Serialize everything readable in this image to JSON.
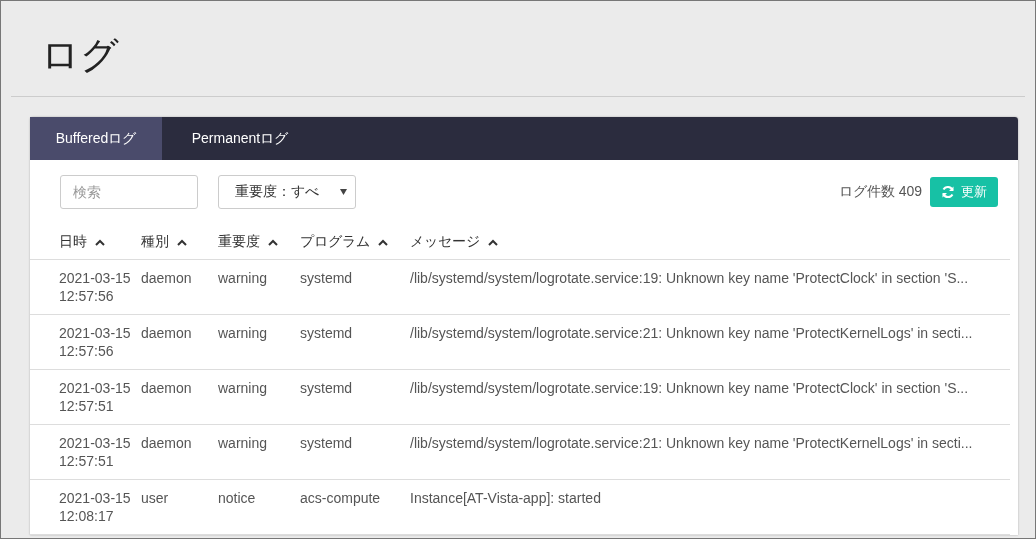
{
  "page": {
    "title": "ログ"
  },
  "tabs": [
    {
      "label": "Bufferedログ",
      "selected": true
    },
    {
      "label": "Permanentログ",
      "selected": false
    }
  ],
  "search": {
    "placeholder": "検索"
  },
  "severity_filter": {
    "value": "重要度：すべ"
  },
  "log_count": "ログ件数 409",
  "refresh_button": "更新",
  "table": {
    "columns": [
      "日時",
      "種別",
      "重要度",
      "プログラム",
      "メッセージ"
    ],
    "rows": [
      {
        "date": "2021-03-15",
        "time": "12:57:56",
        "type": "daemon",
        "severity": "warning",
        "program": "systemd",
        "message": "/lib/systemd/system/logrotate.service:19: Unknown key name 'ProtectClock' in section 'S..."
      },
      {
        "date": "2021-03-15",
        "time": "12:57:56",
        "type": "daemon",
        "severity": "warning",
        "program": "systemd",
        "message": "/lib/systemd/system/logrotate.service:21: Unknown key name 'ProtectKernelLogs' in secti..."
      },
      {
        "date": "2021-03-15",
        "time": "12:57:51",
        "type": "daemon",
        "severity": "warning",
        "program": "systemd",
        "message": "/lib/systemd/system/logrotate.service:19: Unknown key name 'ProtectClock' in section 'S..."
      },
      {
        "date": "2021-03-15",
        "time": "12:57:51",
        "type": "daemon",
        "severity": "warning",
        "program": "systemd",
        "message": "/lib/systemd/system/logrotate.service:21: Unknown key name 'ProtectKernelLogs' in secti..."
      },
      {
        "date": "2021-03-15",
        "time": "12:08:17",
        "type": "user",
        "severity": "notice",
        "program": "acs-compute",
        "message": "Instance[AT-Vista-app]: started"
      }
    ]
  }
}
